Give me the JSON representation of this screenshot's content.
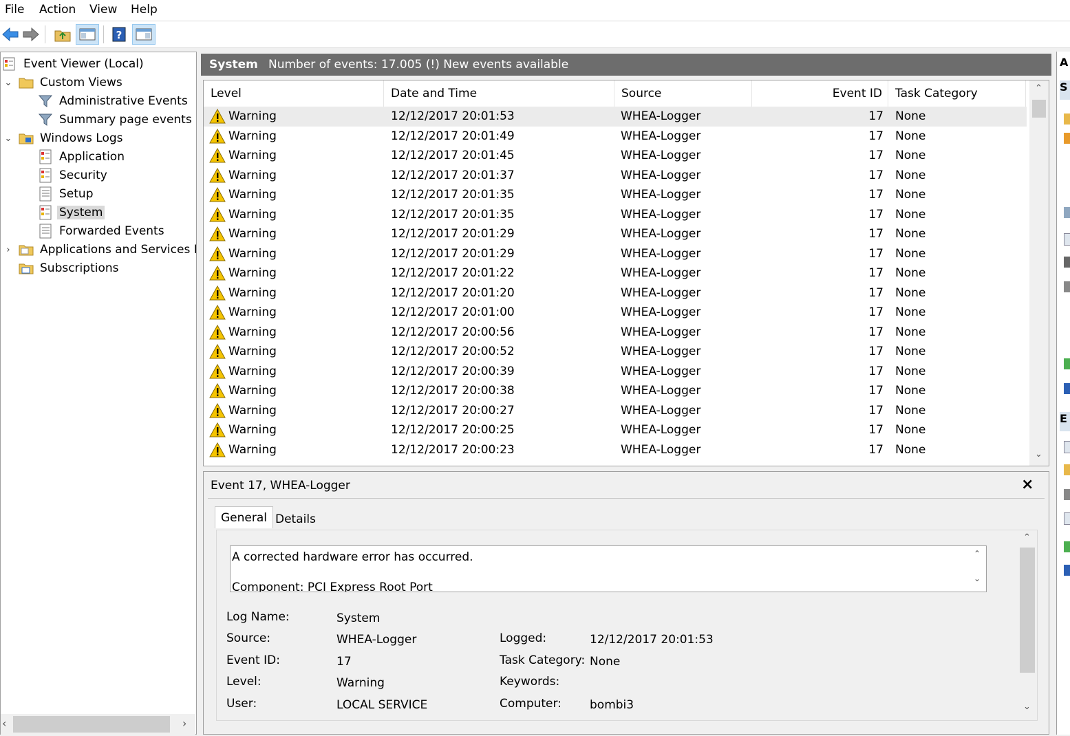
{
  "menu": [
    "File",
    "Action",
    "View",
    "Help"
  ],
  "toolbar": {
    "icons": [
      "back-arrow-icon",
      "forward-arrow-icon",
      "up-folder-icon",
      "show-hide-console-tree-icon",
      "help-icon",
      "show-hide-action-pane-icon"
    ]
  },
  "tree": {
    "root": "Event Viewer (Local)",
    "custom_views": "Custom Views",
    "administrative_events": "Administrative Events",
    "summary_page_events": "Summary page events",
    "windows_logs": "Windows Logs",
    "application": "Application",
    "security": "Security",
    "setup": "Setup",
    "system": "System",
    "forwarded_events": "Forwarded Events",
    "apps_services_logs": "Applications and Services Log",
    "subscriptions": "Subscriptions"
  },
  "header": {
    "title": "System",
    "count_text": "Number of events: 17.005 (!) New events available"
  },
  "columns": {
    "level": "Level",
    "datetime": "Date and Time",
    "source": "Source",
    "event_id": "Event ID",
    "task_category": "Task Category"
  },
  "events": [
    {
      "level": "Warning",
      "datetime": "12/12/2017 20:01:53",
      "source": "WHEA-Logger",
      "event_id": "17",
      "category": "None"
    },
    {
      "level": "Warning",
      "datetime": "12/12/2017 20:01:49",
      "source": "WHEA-Logger",
      "event_id": "17",
      "category": "None"
    },
    {
      "level": "Warning",
      "datetime": "12/12/2017 20:01:45",
      "source": "WHEA-Logger",
      "event_id": "17",
      "category": "None"
    },
    {
      "level": "Warning",
      "datetime": "12/12/2017 20:01:37",
      "source": "WHEA-Logger",
      "event_id": "17",
      "category": "None"
    },
    {
      "level": "Warning",
      "datetime": "12/12/2017 20:01:35",
      "source": "WHEA-Logger",
      "event_id": "17",
      "category": "None"
    },
    {
      "level": "Warning",
      "datetime": "12/12/2017 20:01:35",
      "source": "WHEA-Logger",
      "event_id": "17",
      "category": "None"
    },
    {
      "level": "Warning",
      "datetime": "12/12/2017 20:01:29",
      "source": "WHEA-Logger",
      "event_id": "17",
      "category": "None"
    },
    {
      "level": "Warning",
      "datetime": "12/12/2017 20:01:29",
      "source": "WHEA-Logger",
      "event_id": "17",
      "category": "None"
    },
    {
      "level": "Warning",
      "datetime": "12/12/2017 20:01:22",
      "source": "WHEA-Logger",
      "event_id": "17",
      "category": "None"
    },
    {
      "level": "Warning",
      "datetime": "12/12/2017 20:01:20",
      "source": "WHEA-Logger",
      "event_id": "17",
      "category": "None"
    },
    {
      "level": "Warning",
      "datetime": "12/12/2017 20:01:00",
      "source": "WHEA-Logger",
      "event_id": "17",
      "category": "None"
    },
    {
      "level": "Warning",
      "datetime": "12/12/2017 20:00:56",
      "source": "WHEA-Logger",
      "event_id": "17",
      "category": "None"
    },
    {
      "level": "Warning",
      "datetime": "12/12/2017 20:00:52",
      "source": "WHEA-Logger",
      "event_id": "17",
      "category": "None"
    },
    {
      "level": "Warning",
      "datetime": "12/12/2017 20:00:39",
      "source": "WHEA-Logger",
      "event_id": "17",
      "category": "None"
    },
    {
      "level": "Warning",
      "datetime": "12/12/2017 20:00:38",
      "source": "WHEA-Logger",
      "event_id": "17",
      "category": "None"
    },
    {
      "level": "Warning",
      "datetime": "12/12/2017 20:00:27",
      "source": "WHEA-Logger",
      "event_id": "17",
      "category": "None"
    },
    {
      "level": "Warning",
      "datetime": "12/12/2017 20:00:25",
      "source": "WHEA-Logger",
      "event_id": "17",
      "category": "None"
    },
    {
      "level": "Warning",
      "datetime": "12/12/2017 20:00:23",
      "source": "WHEA-Logger",
      "event_id": "17",
      "category": "None"
    }
  ],
  "detail": {
    "title": "Event 17, WHEA-Logger",
    "close": "×",
    "tabs": [
      "General",
      "Details"
    ],
    "description_line1": "A corrected hardware error has occurred.",
    "description_line2": "Component: PCI Express Root Port",
    "labels": {
      "log_name": "Log Name:",
      "source": "Source:",
      "event_id": "Event ID:",
      "level": "Level:",
      "user": "User:",
      "logged": "Logged:",
      "task_category": "Task Category:",
      "keywords": "Keywords:",
      "computer": "Computer:"
    },
    "values": {
      "log_name": "System",
      "source": "WHEA-Logger",
      "event_id": "17",
      "level": "Warning",
      "user": "LOCAL SERVICE",
      "logged": "12/12/2017 20:01:53",
      "task_category": "None",
      "keywords": "",
      "computer": "bombi3"
    }
  },
  "actions_pane": {
    "header1": "A",
    "header2": "S",
    "header3": "E"
  },
  "colors": {
    "header_bg": "#6d6d6d",
    "selected_row": "#ebebeb",
    "warning_yellow": "#f5c400",
    "toolbar_pressed": "#cce4f7"
  }
}
